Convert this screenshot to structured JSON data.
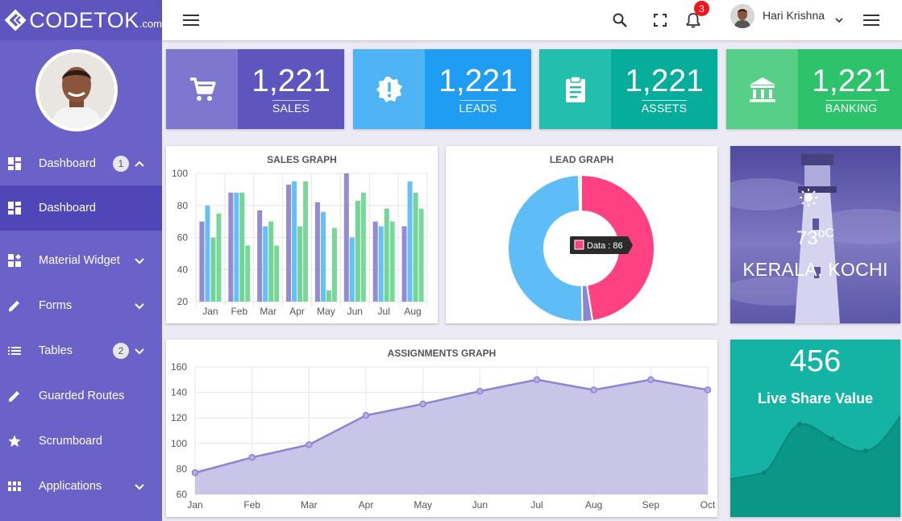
{
  "brand": {
    "name": "CODETOK",
    "suffix": ".com"
  },
  "sidebar": {
    "items": [
      {
        "label": "Dashboard",
        "badge": "1",
        "icon": "dashboard-icon",
        "expanded": true
      },
      {
        "label": "Dashboard",
        "icon": "dashboard-icon",
        "active": true
      },
      {
        "label": "Material Widget",
        "icon": "widgets-icon"
      },
      {
        "label": "Forms",
        "icon": "pencil-icon"
      },
      {
        "label": "Tables",
        "badge": "2",
        "icon": "list-icon"
      },
      {
        "label": "Guarded Routes",
        "icon": "pencil-icon"
      },
      {
        "label": "Scrumboard",
        "icon": "star-icon"
      },
      {
        "label": "Applications",
        "icon": "apps-icon"
      }
    ]
  },
  "topbar": {
    "notifications": "3",
    "user_name": "Hari Krishna"
  },
  "stats": [
    {
      "value": "1,221",
      "label": "SALES",
      "icon": "cart-icon",
      "dark": "#5d56bf",
      "light": "#7c77cf"
    },
    {
      "value": "1,221",
      "label": "LEADS",
      "icon": "alert-badge-icon",
      "dark": "#1e9df2",
      "light": "#4fb4f5"
    },
    {
      "value": "1,221",
      "label": "ASSETS",
      "icon": "clipboard-icon",
      "dark": "#07ad9b",
      "light": "#23bfae"
    },
    {
      "value": "1,221",
      "label": "BANKING",
      "icon": "bank-icon",
      "dark": "#2dc36a",
      "light": "#58cf88"
    }
  ],
  "weather": {
    "temp": "73",
    "unit": "oC",
    "city": "KERALA, KOCHI",
    "icon": "sun-icon"
  },
  "share": {
    "value": "456",
    "label": "Live Share Value"
  },
  "colors": {
    "purple": "#8b86d3",
    "blue": "#5ebcf6",
    "green": "#69d38f",
    "pink": "#ff4081",
    "area": "#c5c2e8",
    "line": "#8b86d3"
  },
  "chart_data": [
    {
      "type": "bar",
      "title": "SALES GRAPH",
      "categories": [
        "Jan",
        "Feb",
        "Mar",
        "Apr",
        "May",
        "Jun",
        "Jul",
        "Aug"
      ],
      "series": [
        {
          "values": [
            70,
            88,
            77,
            93,
            82,
            100,
            70,
            67
          ]
        },
        {
          "values": [
            80,
            88,
            67,
            95,
            76,
            60,
            67,
            95
          ]
        },
        {
          "values": [
            60,
            88,
            70,
            67,
            27,
            83,
            78,
            88
          ]
        },
        {
          "values": [
            75,
            55,
            55,
            95,
            66,
            88,
            70,
            78
          ]
        }
      ],
      "ylim": [
        20,
        100
      ],
      "yticks": [
        20,
        40,
        60,
        80,
        100
      ]
    },
    {
      "type": "pie",
      "title": "LEAD GRAPH",
      "values": [
        86,
        4,
        90,
        1
      ],
      "tooltip": "Data : 86"
    },
    {
      "type": "area",
      "title": "ASSIGNMENTS GRAPH",
      "categories": [
        "Jan",
        "Feb",
        "Mar",
        "Apr",
        "May",
        "Jun",
        "Jul",
        "Aug",
        "Sep",
        "Oct"
      ],
      "values": [
        77,
        89,
        99,
        122,
        131,
        141,
        150,
        142,
        150,
        142
      ],
      "ylim": [
        60,
        160
      ],
      "yticks": [
        60,
        80,
        100,
        120,
        140,
        160
      ]
    }
  ]
}
